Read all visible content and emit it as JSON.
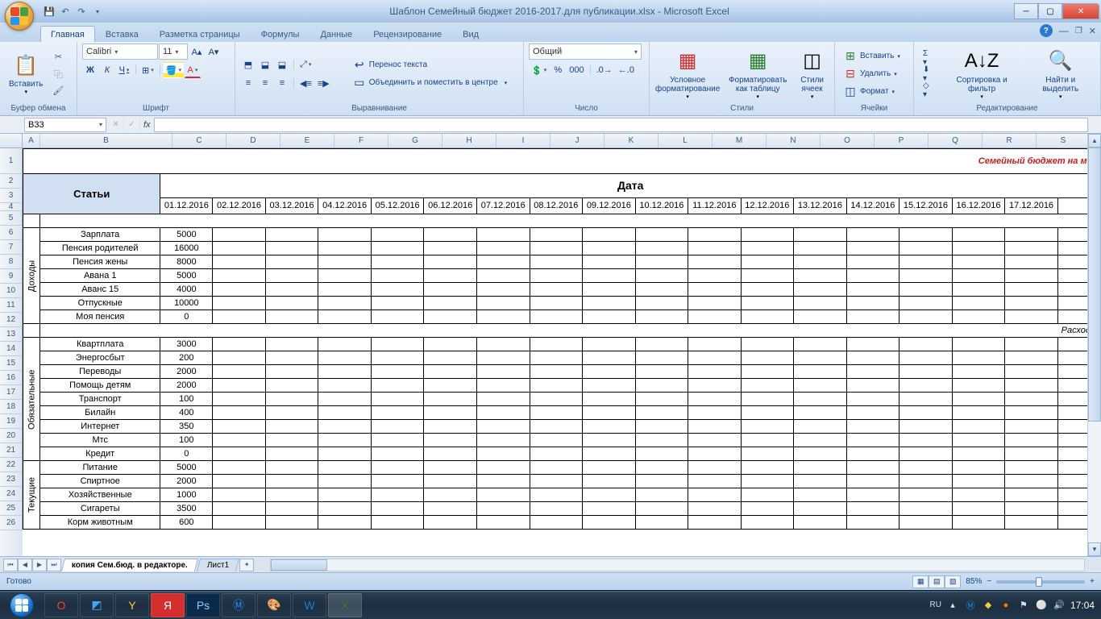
{
  "title": "Шаблон Семейный бюджет 2016-2017.для публикации.xlsx - Microsoft Excel",
  "tabs": [
    "Главная",
    "Вставка",
    "Разметка страницы",
    "Формулы",
    "Данные",
    "Рецензирование",
    "Вид"
  ],
  "activeTab": "Главная",
  "ribbon": {
    "clipboard": {
      "paste": "Вставить",
      "label": "Буфер обмена"
    },
    "font": {
      "name": "Calibri",
      "size": "11",
      "label": "Шрифт"
    },
    "alignment": {
      "wrap": "Перенос текста",
      "merge": "Объединить и поместить в центре",
      "label": "Выравнивание"
    },
    "number": {
      "format": "Общий",
      "label": "Число"
    },
    "styles": {
      "cond": "Условное\nформатирование",
      "table": "Форматировать\nкак таблицу",
      "cell": "Стили\nячеек",
      "label": "Стили"
    },
    "cells": {
      "insert": "Вставить",
      "delete": "Удалить",
      "format": "Формат",
      "label": "Ячейки"
    },
    "editing": {
      "sort": "Сортировка\nи фильтр",
      "find": "Найти и\nвыделить",
      "label": "Редактирование"
    }
  },
  "namebox": "B33",
  "columns": [
    "A",
    "B",
    "C",
    "D",
    "E",
    "F",
    "G",
    "H",
    "I",
    "J",
    "K",
    "L",
    "M",
    "N",
    "O",
    "P",
    "Q",
    "R",
    "S"
  ],
  "sheetTitle": "Семейный бюджет на мес",
  "headerArticles": "Статьи",
  "headerDate": "Дата",
  "dates": [
    "01.12.2016",
    "02.12.2016",
    "03.12.2016",
    "04.12.2016",
    "05.12.2016",
    "06.12.2016",
    "07.12.2016",
    "08.12.2016",
    "09.12.2016",
    "10.12.2016",
    "11.12.2016",
    "12.12.2016",
    "13.12.2016",
    "14.12.2016",
    "15.12.2016",
    "16.12.2016",
    "17.12.2016"
  ],
  "sections": {
    "income": {
      "label": "Доходы",
      "rows": [
        {
          "name": "Зарплата",
          "val": "5000"
        },
        {
          "name": "Пенсия родителей",
          "val": "16000"
        },
        {
          "name": "Пенсия жены",
          "val": "8000"
        },
        {
          "name": "Авана 1",
          "val": "5000"
        },
        {
          "name": "Аванс 15",
          "val": "4000"
        },
        {
          "name": "Отпускные",
          "val": "10000"
        },
        {
          "name": "Моя пенсия",
          "val": "0"
        }
      ]
    },
    "expHeader": "Расходы",
    "mandatory": {
      "label": "Обязательные",
      "rows": [
        {
          "name": "Квартплата",
          "val": "3000"
        },
        {
          "name": "Энергосбыт",
          "val": "200"
        },
        {
          "name": "Переводы",
          "val": "2000"
        },
        {
          "name": "Помощь детям",
          "val": "2000"
        },
        {
          "name": "Транспорт",
          "val": "100"
        },
        {
          "name": "Билайн",
          "val": "400"
        },
        {
          "name": "Интернет",
          "val": "350"
        },
        {
          "name": "Мтс",
          "val": "100"
        },
        {
          "name": "Кредит",
          "val": "0"
        }
      ]
    },
    "current": {
      "label": "Текущие",
      "rows": [
        {
          "name": "Питание",
          "val": "5000"
        },
        {
          "name": "Спиртное",
          "val": "2000"
        },
        {
          "name": "Хозяйственные",
          "val": "1000"
        },
        {
          "name": "Сигареты",
          "val": "3500"
        },
        {
          "name": "Корм животным",
          "val": "600"
        }
      ]
    }
  },
  "sheetTabs": [
    {
      "name": "копия Сем.бюд. в редакторе.",
      "active": true
    },
    {
      "name": "Лист1",
      "active": false
    }
  ],
  "status": {
    "ready": "Готово",
    "zoom": "85%",
    "lang": "RU",
    "time": "17:04"
  }
}
